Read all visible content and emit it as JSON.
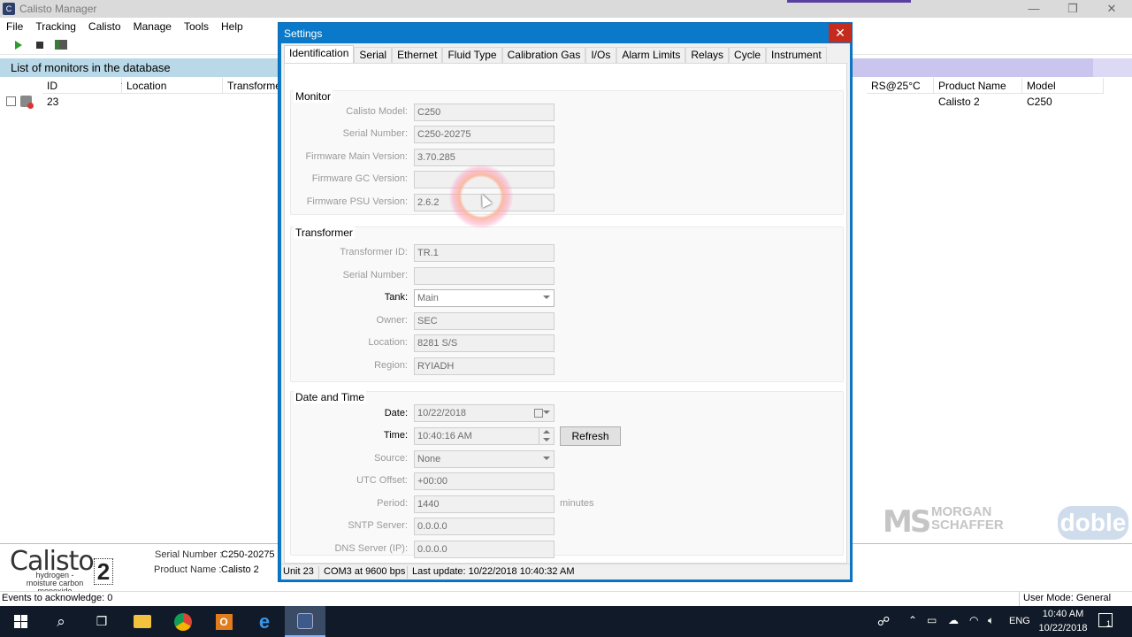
{
  "window": {
    "title": "Calisto Manager",
    "controls": [
      "minimize-icon",
      "restore-icon",
      "close-icon"
    ]
  },
  "menu": [
    "File",
    "Tracking",
    "Calisto",
    "Manage",
    "Tools",
    "Help"
  ],
  "toolbar": {
    "icons": [
      "play-icon",
      "stop-icon",
      "export-icon"
    ]
  },
  "list": {
    "title": "List of monitors in the database",
    "columns": {
      "id": "ID",
      "location": "Location",
      "transformer": "Transforme",
      "rs": "RS@25°C",
      "product_name": "Product Name",
      "model": "Model"
    },
    "rows": [
      {
        "id": "23",
        "product_name": "Calisto 2",
        "model": "C250"
      }
    ]
  },
  "info_panel": {
    "logo_word": "Calisto",
    "logo_number": "2",
    "logo_subtitle": "hydrogen - moisture carbon monoxide",
    "serial_label": "Serial Number :",
    "serial_value": "C250-20275",
    "product_label": "Product Name :",
    "product_value": "Calisto 2"
  },
  "brands": {
    "ms": "MS",
    "morgan_schaffer": "MORGAN SCHAFFER",
    "doble": "doble"
  },
  "status": {
    "events": "Events to acknowledge: 0",
    "user_mode": "User Mode: General"
  },
  "dialog": {
    "title": "Settings",
    "tabs": [
      "Identification",
      "Serial",
      "Ethernet",
      "Fluid Type",
      "Calibration Gas",
      "I/Os",
      "Alarm Limits",
      "Relays",
      "Cycle",
      "Instrument"
    ],
    "active_tab": "Identification",
    "monitor": {
      "title": "Monitor",
      "calisto_model_label": "Calisto Model:",
      "calisto_model": "C250",
      "serial_number_label": "Serial Number:",
      "serial_number": "C250-20275",
      "fw_main_label": "Firmware Main Version:",
      "fw_main": "3.70.285",
      "fw_gc_label": "Firmware GC Version:",
      "fw_gc": "",
      "fw_psu_label": "Firmware PSU Version:",
      "fw_psu": "2.6.2"
    },
    "transformer": {
      "title": "Transformer",
      "id_label": "Transformer ID:",
      "id": "TR.1",
      "serial_label": "Serial Number:",
      "serial": "",
      "tank_label": "Tank:",
      "tank": "Main",
      "owner_label": "Owner:",
      "owner": "SEC",
      "location_label": "Location:",
      "location": "8281 S/S",
      "region_label": "Region:",
      "region": "RYIADH"
    },
    "datetime": {
      "title": "Date and Time",
      "date_label": "Date:",
      "date": "10/22/2018",
      "time_label": "Time:",
      "time": "10:40:16 AM",
      "refresh_label": "Refresh",
      "source_label": "Source:",
      "source": "None",
      "utc_label": "UTC Offset:",
      "utc": "+00:00",
      "period_label": "Period:",
      "period": "1440",
      "period_unit": "minutes",
      "sntp_label": "SNTP Server:",
      "sntp": "0.0.0.0",
      "dns_label": "DNS Server (IP):",
      "dns": "0.0.0.0"
    },
    "statusbar": {
      "unit": "Unit 23",
      "port": "COM3 at 9600 bps",
      "last_update": "Last update: 10/22/2018 10:40:32 AM"
    }
  },
  "taskbar": {
    "apps": [
      "windows-start-icon",
      "search-icon",
      "task-view-icon",
      "file-explorer-icon",
      "chrome-icon",
      "outlook-icon",
      "edge-icon",
      "calisto-manager-icon"
    ],
    "language": "ENG",
    "time": "10:40 AM",
    "date": "10/22/2018",
    "notification_count": "1"
  }
}
